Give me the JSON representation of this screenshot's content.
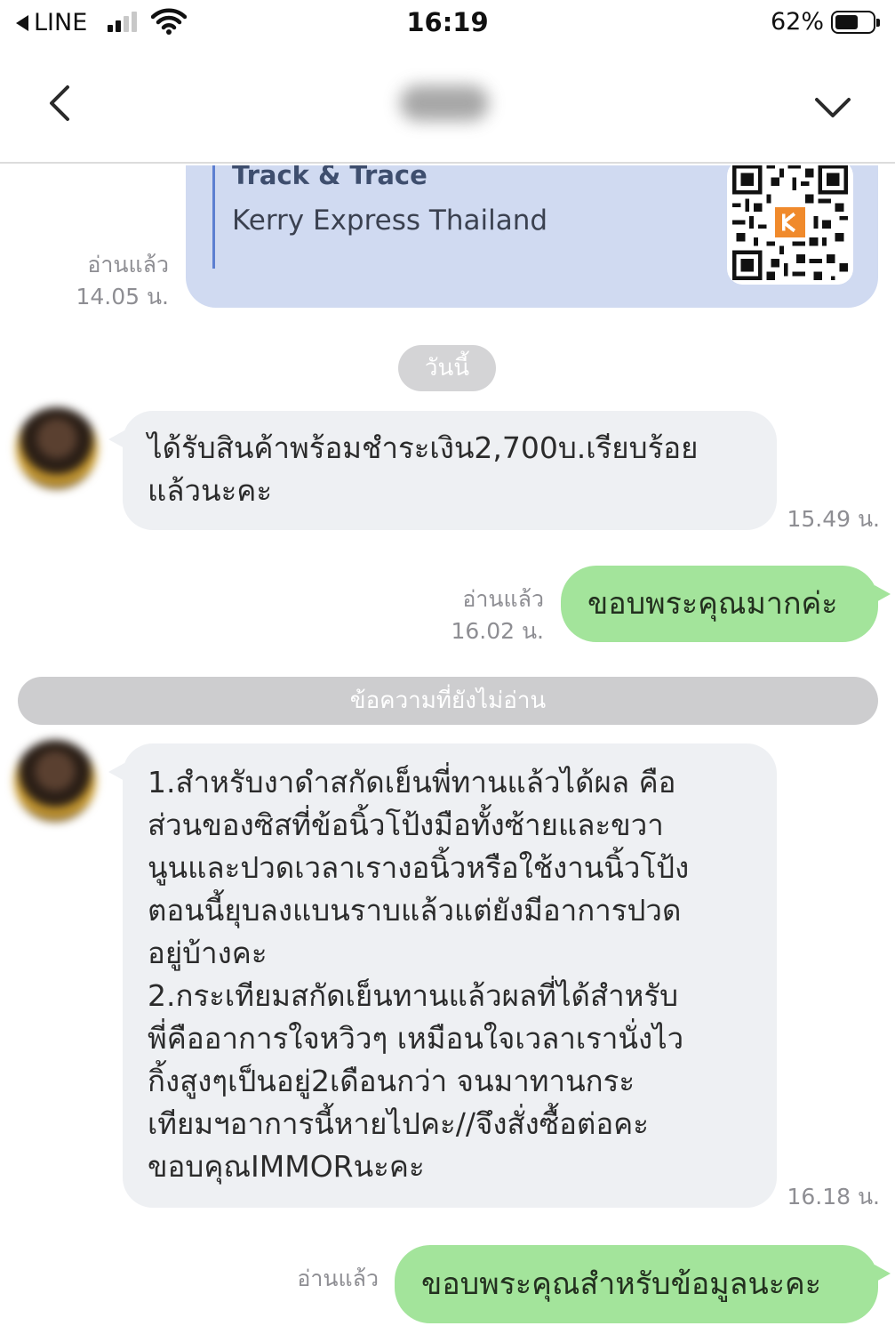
{
  "status_bar": {
    "back_app_label": "LINE",
    "time": "16:19",
    "battery_percent": "62%",
    "battery_level": 0.62,
    "signal_bars": 2
  },
  "nav": {
    "back_icon": "chevron-left-icon",
    "menu_icon": "chevron-down-icon"
  },
  "messages": {
    "track_card": {
      "title": "Track & Trace",
      "subtitle": "Kerry Express Thailand",
      "read_label": "อ่านแล้ว",
      "time": "14.05 น."
    },
    "date_separator": "วันนี้",
    "incoming_1": {
      "lines": [
        "ได้รับสินค้าพร้อมชำระเงิน2,700บ.เรียบร้อย",
        "แล้วนะคะ"
      ],
      "time": "15.49 น."
    },
    "outgoing_1": {
      "text": "ขอบพระคุณมากค่ะ",
      "read_label": "อ่านแล้ว",
      "time": "16.02 น."
    },
    "unread_separator": "ข้อความที่ยังไม่อ่าน",
    "incoming_2": {
      "lines": [
        "1.สำหรับงาดำสกัดเย็นพี่ทานแล้วได้ผล คือ",
        "ส่วนของซิสที่ข้อนิ้วโป้งมือทั้งซ้ายและขวา",
        "นูนและปวดเวลาเรางอนิ้วหรือใช้งานนิ้วโป้ง",
        "ตอนนี้ยุบลงแบนราบแล้วแต่ยังมีอาการปวด",
        "อยู่บ้างคะ",
        "2.กระเทียมสกัดเย็นทานแล้วผลที่ได้สำหรับ",
        "พี่คืออาการใจหวิวๆ เหมือนใจเวลาเรานั่งไว",
        "กิ้งสูงๆเป็นอยู่2เดือนกว่า จนมาทานกระ",
        "เทียมฯอาการนี้หายไปคะ//จึงสั่งซื้อต่อคะ",
        "ขอบคุณIMMORนะคะ"
      ],
      "time": "16.18 น."
    },
    "outgoing_2": {
      "text": "ขอบพระคุณสำหรับข้อมูลนะคะ",
      "read_label": "อ่านแล้ว"
    }
  }
}
